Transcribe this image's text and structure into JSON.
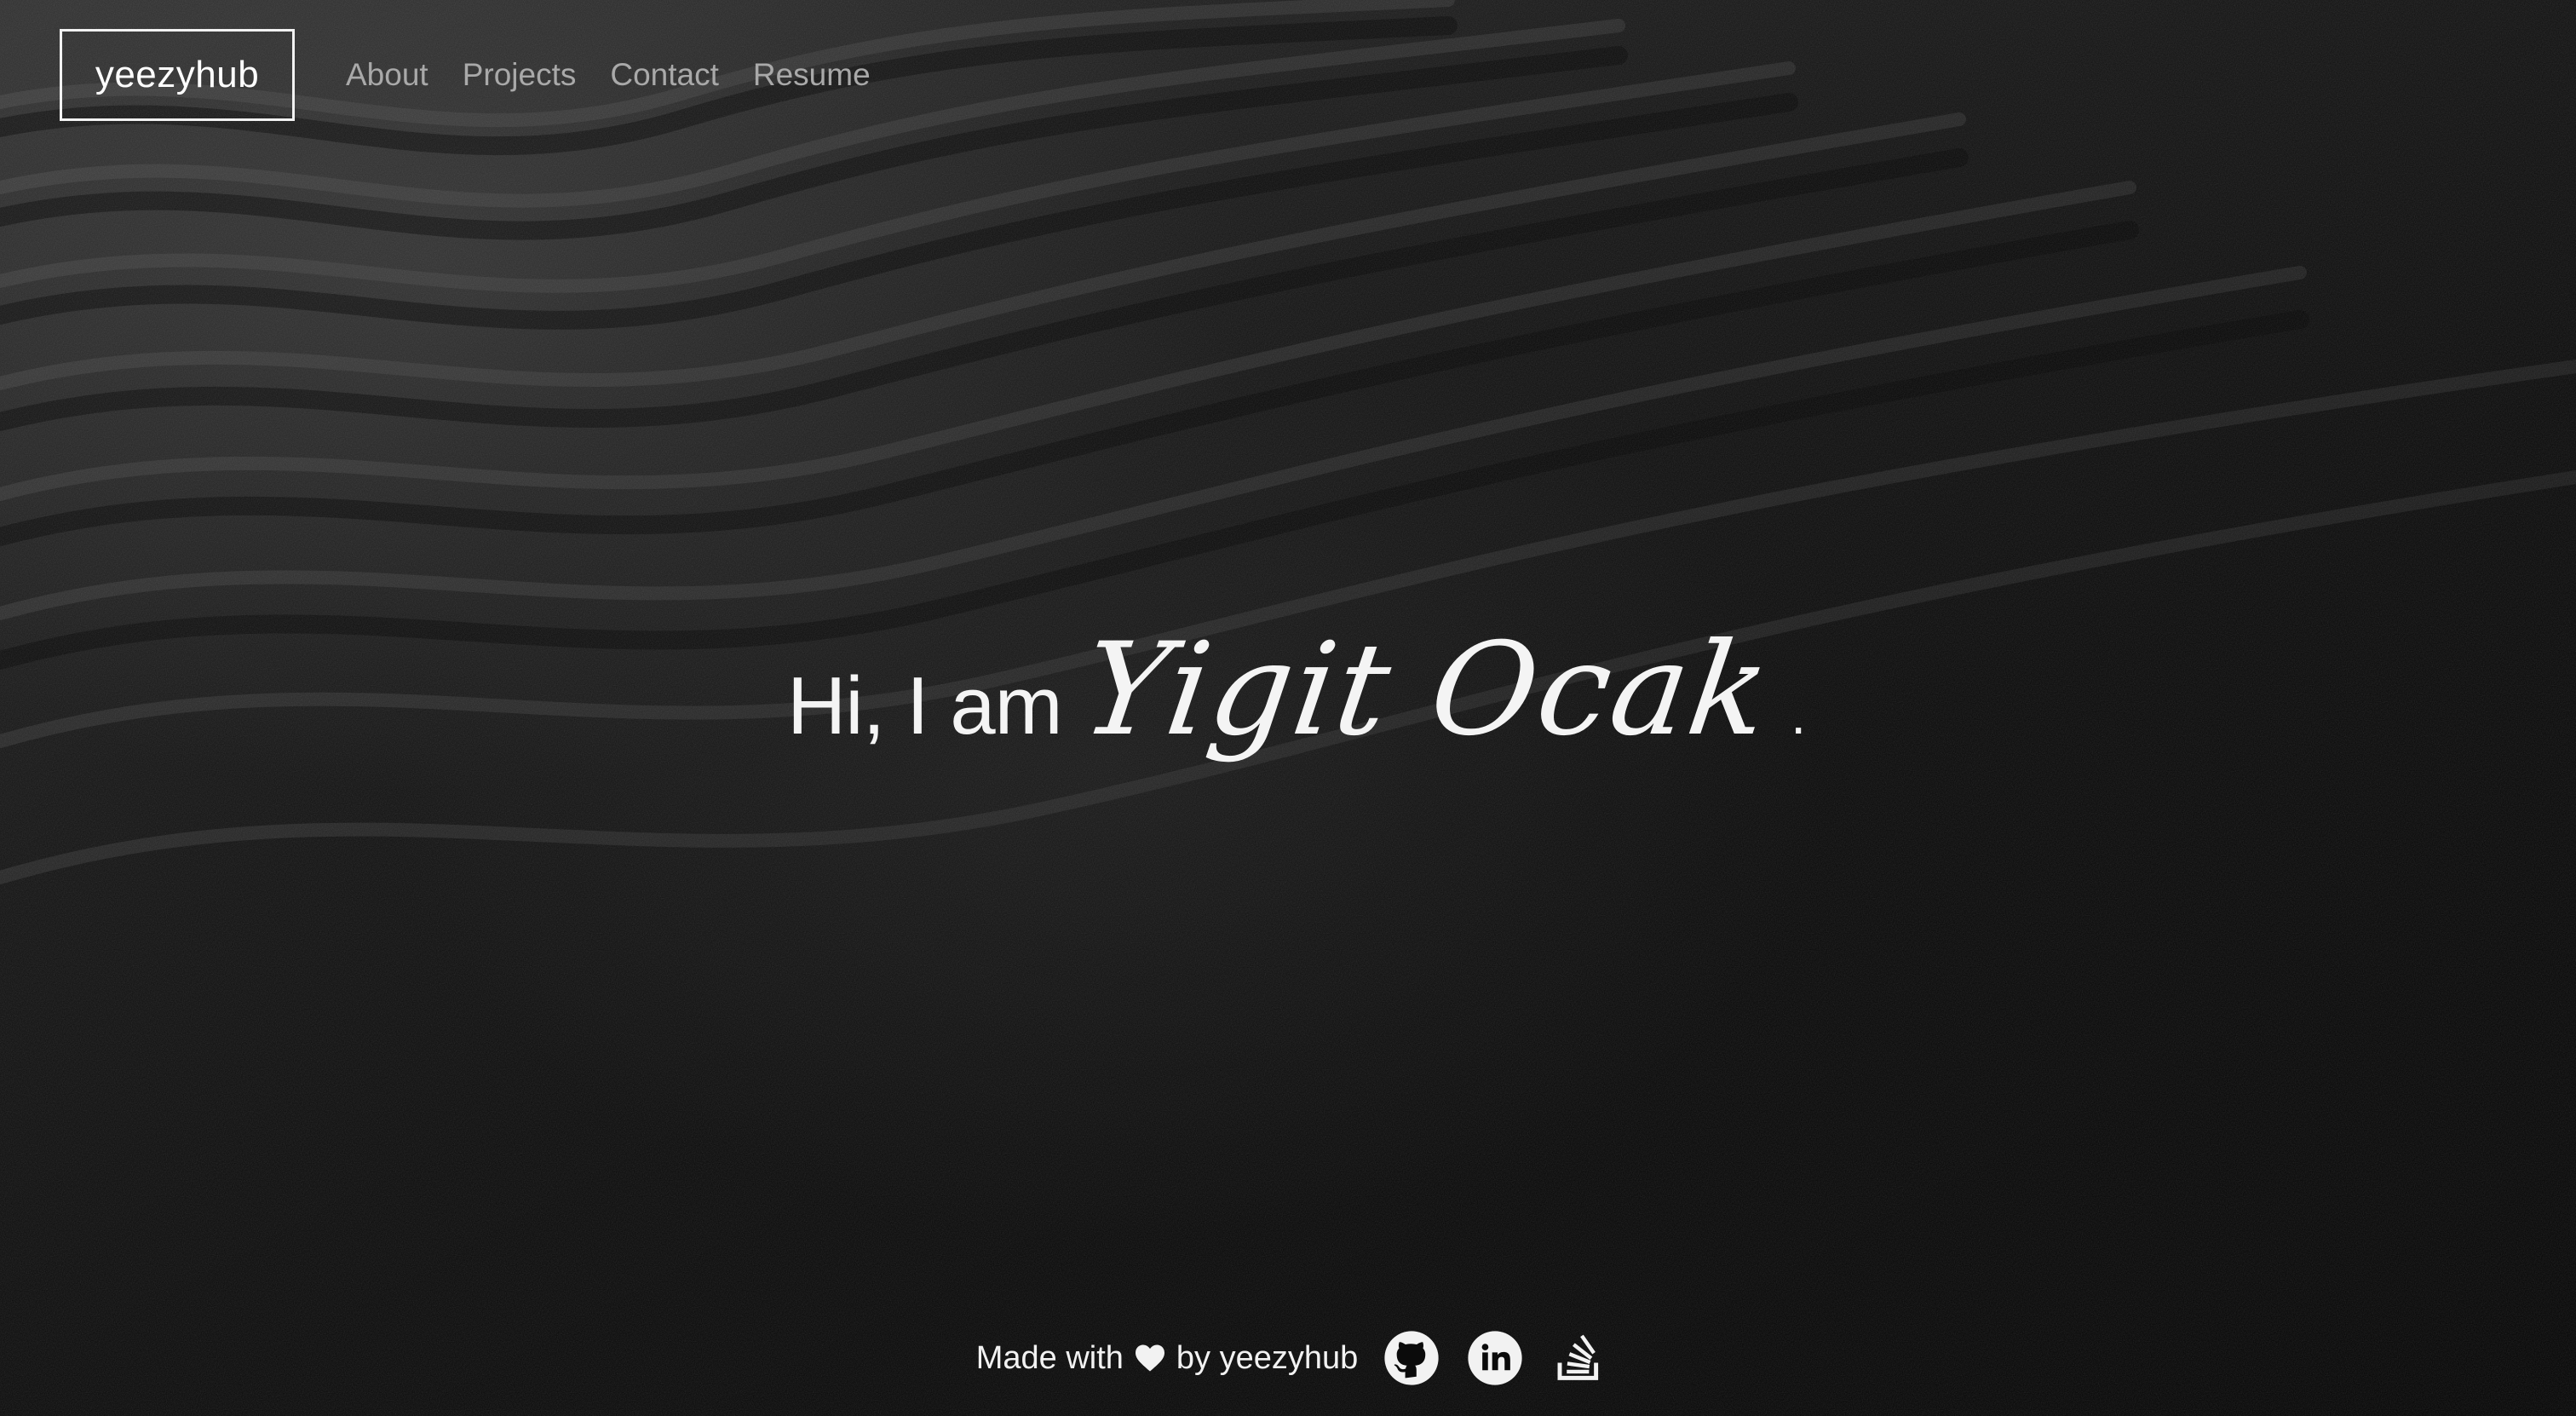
{
  "nav": {
    "brand": "yeezyhub",
    "links": [
      {
        "label": "About"
      },
      {
        "label": "Projects"
      },
      {
        "label": "Contact"
      },
      {
        "label": "Resume"
      }
    ]
  },
  "hero": {
    "prefix": "Hi, I am",
    "name": "Yigit Ocak",
    "suffix": "."
  },
  "footer": {
    "made_with": "Made with",
    "by": "by yeezyhub",
    "heart_icon": "heart-icon",
    "social": [
      {
        "icon": "github-icon"
      },
      {
        "icon": "linkedin-icon"
      },
      {
        "icon": "stackoverflow-icon"
      }
    ]
  },
  "colors": {
    "background": "#0b0b0b",
    "text": "#f4f4f4",
    "nav_link": "#a9a9a9",
    "brand_border": "#f2f2f2"
  }
}
